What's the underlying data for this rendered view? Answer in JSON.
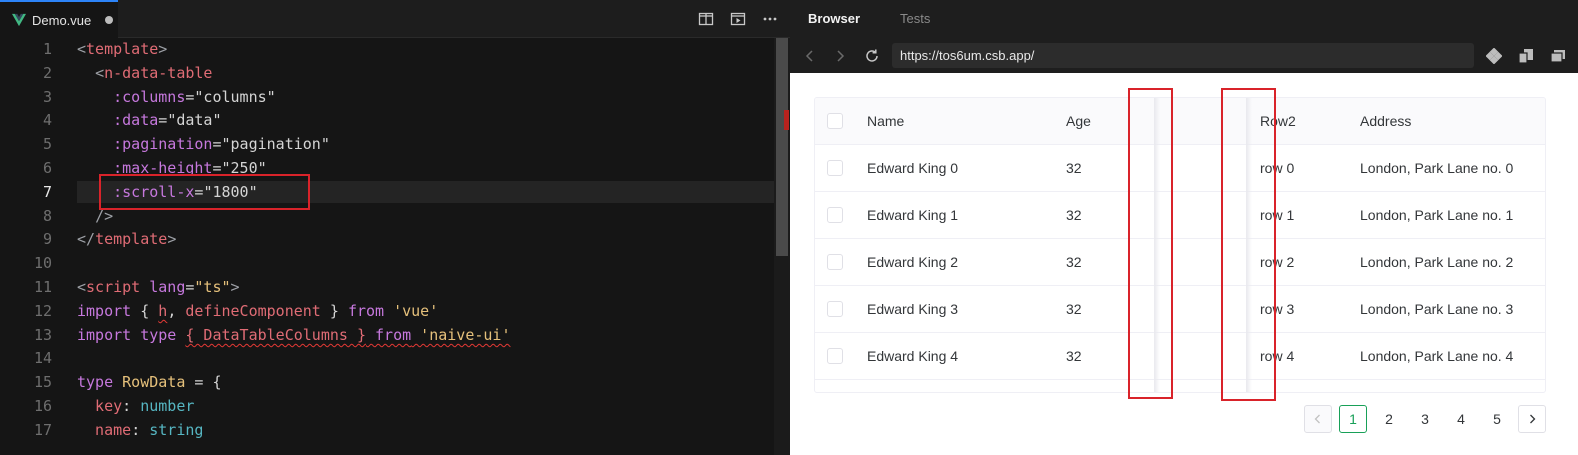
{
  "editor": {
    "tab_label": "Demo.vue",
    "current_line": 7,
    "lines": [
      {
        "n": "1"
      },
      {
        "n": "2"
      },
      {
        "n": "3"
      },
      {
        "n": "4"
      },
      {
        "n": "5"
      },
      {
        "n": "6"
      },
      {
        "n": "7"
      },
      {
        "n": "8"
      },
      {
        "n": "9"
      },
      {
        "n": "10"
      },
      {
        "n": "11"
      },
      {
        "n": "12"
      },
      {
        "n": "13"
      },
      {
        "n": "14"
      },
      {
        "n": "15"
      },
      {
        "n": "16"
      },
      {
        "n": "17"
      }
    ],
    "code": {
      "l1_open": "<",
      "l1_tag": "template",
      "l1_close": ">",
      "l2_open": "<",
      "l2_tag": "n-data-table",
      "l3_attr": ":columns",
      "l3_eq": "=",
      "l3_val": "\"columns\"",
      "l4_attr": ":data",
      "l4_eq": "=",
      "l4_val": "\"data\"",
      "l5_attr": ":pagination",
      "l5_eq": "=",
      "l5_val": "\"pagination\"",
      "l6_attr": ":max-height",
      "l6_eq": "=",
      "l6_val": "\"250\"",
      "l7_attr": ":scroll-x",
      "l7_eq": "=",
      "l7_val": "\"1800\"",
      "l8": "/>",
      "l9_open": "</",
      "l9_tag": "template",
      "l9_close": ">",
      "l11_open": "<",
      "l11_tag": "script",
      "l11_attr": "lang",
      "l11_eq": "=",
      "l11_val": "\"ts\"",
      "l11_close": ">",
      "l12_kw": "import",
      "l12_a": " { ",
      "l12_h": "h",
      "l12_b": ", ",
      "l12_dc": "defineComponent",
      "l12_c": " } ",
      "l12_from": "from",
      "l12_str": " 'vue'",
      "l13_kw": "import",
      "l13_type": " type ",
      "l13_obj": "{ DataTableColumns }",
      "l13_from": " from",
      "l13_str": " 'naive-ui'",
      "l15_kw": "type",
      "l15_name": " RowData",
      "l15_rest": " = {",
      "l16_key": "  key",
      "l16_colon": ": ",
      "l16_type": "number",
      "l17_key": "  name",
      "l17_colon": ": ",
      "l17_type": "string"
    }
  },
  "browser": {
    "tabs": [
      "Browser",
      "Tests"
    ],
    "url": "https://tos6um.csb.app/",
    "table": {
      "headers": {
        "name": "Name",
        "age": "Age",
        "row2": "Row2",
        "address": "Address"
      },
      "rows": [
        {
          "name": "Edward King 0",
          "age": "32",
          "row2": "row 0",
          "address": "London, Park Lane no. 0"
        },
        {
          "name": "Edward King 1",
          "age": "32",
          "row2": "row 1",
          "address": "London, Park Lane no. 1"
        },
        {
          "name": "Edward King 2",
          "age": "32",
          "row2": "row 2",
          "address": "London, Park Lane no. 2"
        },
        {
          "name": "Edward King 3",
          "age": "32",
          "row2": "row 3",
          "address": "London, Park Lane no. 3"
        },
        {
          "name": "Edward King 4",
          "age": "32",
          "row2": "row 4",
          "address": "London, Park Lane no. 4"
        }
      ]
    },
    "pagination": {
      "pages": [
        "1",
        "2",
        "3",
        "4",
        "5"
      ],
      "current": "1"
    }
  },
  "colors": {
    "accent": "#18a058",
    "highlight": "#d9232a",
    "tab_indicator": "#2d84f8"
  }
}
